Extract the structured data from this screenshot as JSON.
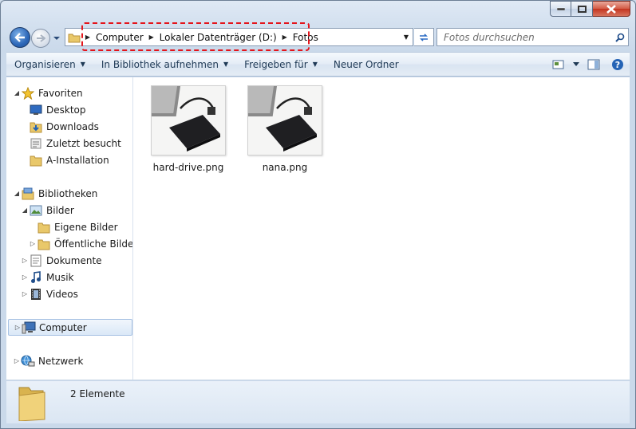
{
  "address": {
    "crumbs": [
      "Computer",
      "Lokaler Datenträger (D:)",
      "Fotos"
    ]
  },
  "search": {
    "placeholder": "Fotos durchsuchen"
  },
  "toolbar": {
    "organize": "Organisieren",
    "library": "In Bibliothek aufnehmen",
    "share": "Freigeben für",
    "new_folder": "Neuer Ordner"
  },
  "nav": {
    "favorites": "Favoriten",
    "desktop": "Desktop",
    "downloads": "Downloads",
    "recent": "Zuletzt besucht",
    "a_install": "A-Installation",
    "libraries": "Bibliotheken",
    "pictures": "Bilder",
    "my_pictures": "Eigene Bilder",
    "public_pictures": "Öffentliche Bilder",
    "documents": "Dokumente",
    "music": "Musik",
    "videos": "Videos",
    "computer": "Computer",
    "network": "Netzwerk"
  },
  "files": [
    {
      "name": "hard-drive.png"
    },
    {
      "name": "nana.png"
    }
  ],
  "status": {
    "count": "2 Elemente"
  },
  "colors": {
    "highlight": "#e4141b",
    "accent": "#2c67b8"
  }
}
